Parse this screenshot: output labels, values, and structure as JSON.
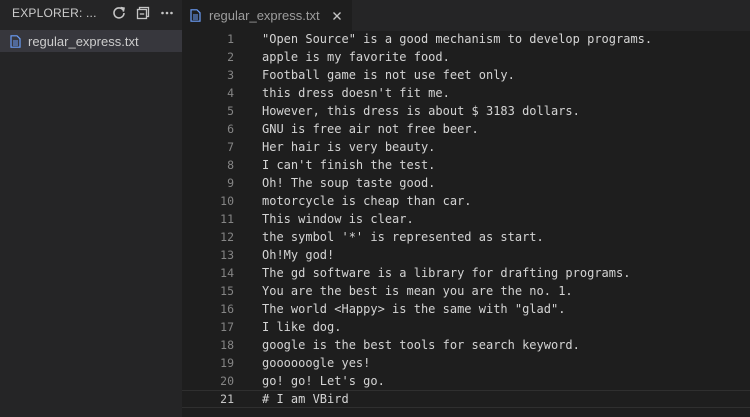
{
  "sidebar": {
    "title": "EXPLORER: ...",
    "actions": [
      {
        "icon": "refresh-icon"
      },
      {
        "icon": "collapse-all-icon"
      },
      {
        "icon": "more-icon"
      }
    ],
    "files": [
      {
        "name": "regular_express.txt",
        "icon": "file-icon"
      }
    ]
  },
  "tabs": [
    {
      "label": "regular_express.txt",
      "icon": "file-icon",
      "close_icon": "close-icon"
    }
  ],
  "editor": {
    "current_line": 21,
    "lines": [
      {
        "n": "1",
        "text": "\"Open Source\" is a good mechanism to develop programs."
      },
      {
        "n": "2",
        "text": "apple is my favorite food."
      },
      {
        "n": "3",
        "text": "Football game is not use feet only."
      },
      {
        "n": "4",
        "text": "this dress doesn't fit me."
      },
      {
        "n": "5",
        "text": "However, this dress is about $ 3183 dollars."
      },
      {
        "n": "6",
        "text": "GNU is free air not free beer."
      },
      {
        "n": "7",
        "text": "Her hair is very beauty."
      },
      {
        "n": "8",
        "text": "I can't finish the test."
      },
      {
        "n": "9",
        "text": "Oh! The soup taste good."
      },
      {
        "n": "10",
        "text": "motorcycle is cheap than car."
      },
      {
        "n": "11",
        "text": "This window is clear."
      },
      {
        "n": "12",
        "text": "the symbol '*' is represented as start."
      },
      {
        "n": "13",
        "text": "Oh!My god!"
      },
      {
        "n": "14",
        "text": "The gd software is a library for drafting programs."
      },
      {
        "n": "15",
        "text": "You are the best is mean you are the no. 1."
      },
      {
        "n": "16",
        "text": "The world <Happy> is the same with \"glad\"."
      },
      {
        "n": "17",
        "text": "I like dog."
      },
      {
        "n": "18",
        "text": "google is the best tools for search keyword."
      },
      {
        "n": "19",
        "text": "goooooogle yes!"
      },
      {
        "n": "20",
        "text": "go! go! Let's go."
      },
      {
        "n": "21",
        "text": "# I am VBird"
      }
    ]
  },
  "colors": {
    "sidebar_bg": "#252526",
    "editor_bg": "#1e1e1e",
    "selected_row": "#37373d",
    "file_icon": "#6c9ef8"
  }
}
